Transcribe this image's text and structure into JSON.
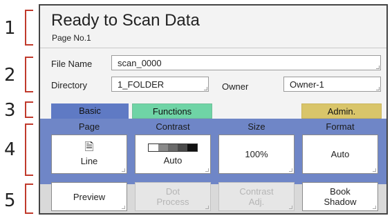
{
  "callouts": [
    "1",
    "2",
    "3",
    "4",
    "5"
  ],
  "header": {
    "title": "Ready to Scan Data",
    "subtitle": "Page No.1"
  },
  "form": {
    "file_name_label": "File Name",
    "file_name_value": "scan_0000",
    "directory_label": "Directory",
    "directory_value": "1_FOLDER",
    "owner_label": "Owner",
    "owner_value": "Owner-1"
  },
  "tabs": [
    {
      "label": "Basic",
      "color": "#5f7ac4"
    },
    {
      "label": "Functions",
      "color": "#6fd4a6"
    },
    {
      "label": "Admin.",
      "color": "#d9c56a"
    }
  ],
  "settings": [
    {
      "heading": "Page",
      "value": "Line",
      "icon": "page-icon"
    },
    {
      "heading": "Contrast",
      "value": "Auto",
      "icon": "contrast-bar-icon"
    },
    {
      "heading": "Size",
      "value": "100%"
    },
    {
      "heading": "Format",
      "value": "Auto"
    }
  ],
  "actions": [
    {
      "line1": "Preview",
      "line2": "",
      "enabled": true
    },
    {
      "line1": "Dot",
      "line2": "Process",
      "enabled": false
    },
    {
      "line1": "Contrast",
      "line2": "Adj.",
      "enabled": false
    },
    {
      "line1": "Book",
      "line2": "Shadow",
      "enabled": true
    }
  ]
}
